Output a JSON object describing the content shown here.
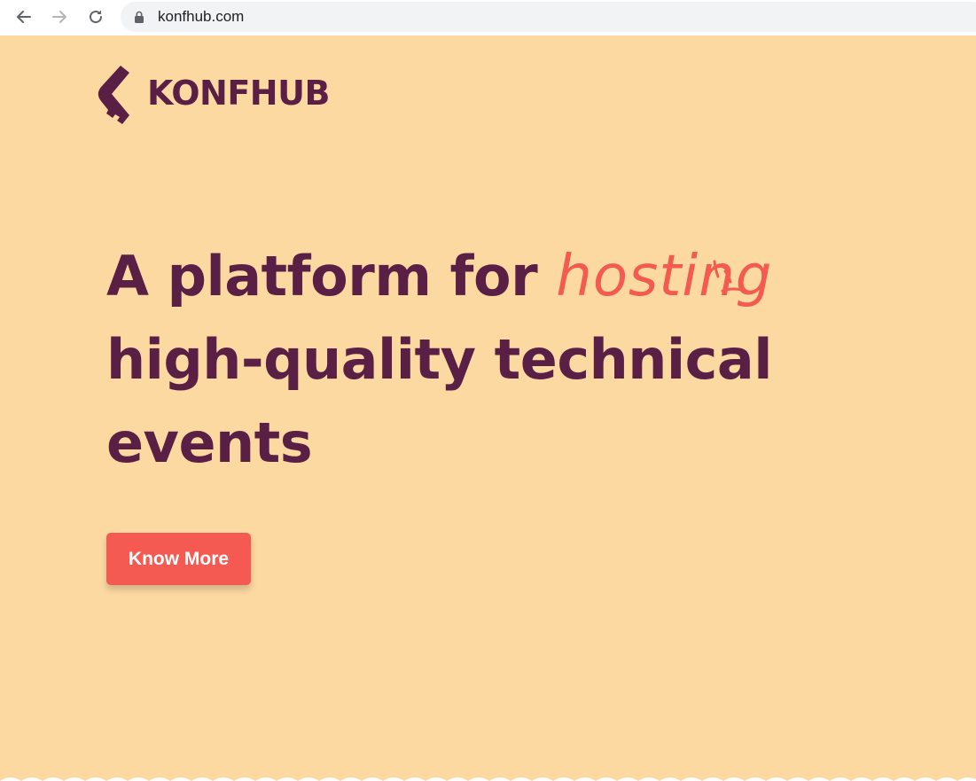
{
  "browser": {
    "url": "konfhub.com",
    "icons": {
      "back": "back-arrow-icon",
      "forward": "forward-arrow-icon",
      "reload": "reload-icon",
      "lock": "lock-icon"
    }
  },
  "brand": {
    "name": "KONFHUB",
    "primary_color": "#5a1f45",
    "accent_color": "#f45a52",
    "background_color": "#fdd9a2"
  },
  "hero": {
    "headline_before": "A platform for ",
    "headline_highlight": "hosting",
    "headline_line2": "high-quality technical",
    "headline_line3": "events",
    "cta_label": "Know More"
  }
}
